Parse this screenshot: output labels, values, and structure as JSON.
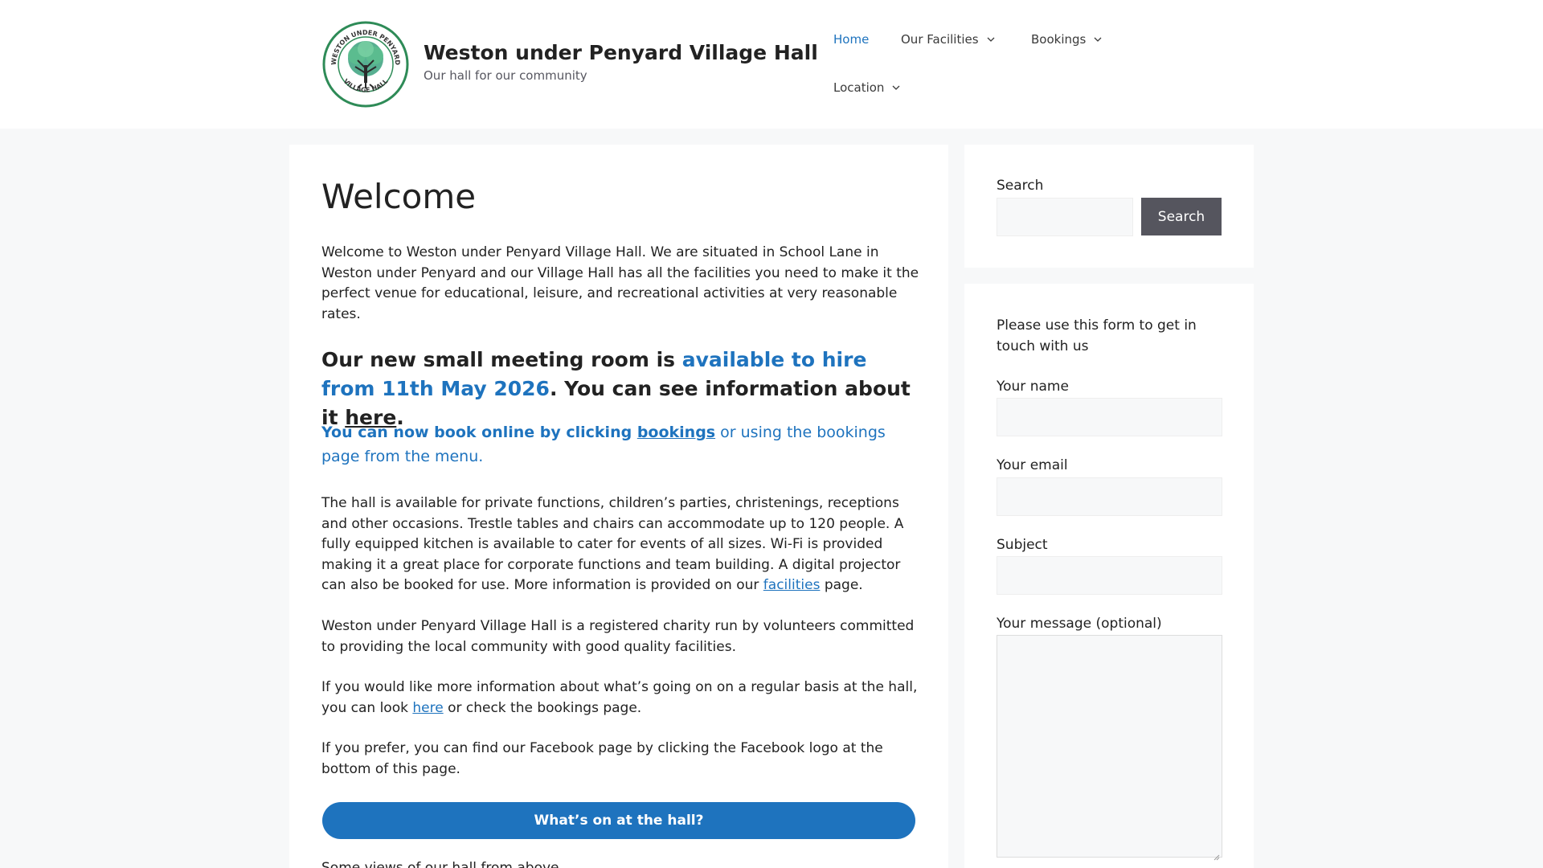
{
  "header": {
    "site_title": "Weston under Penyard Village Hall",
    "tagline": "Our hall for our community",
    "logo_text_top": "WESTON UNDER PENYARD",
    "logo_text_bottom": "VILLAGE HALL",
    "logo_icon": "tree-logo-icon",
    "nav": {
      "home": "Home",
      "facilities": "Our Facilities",
      "bookings": "Bookings",
      "location": "Location"
    }
  },
  "main": {
    "title": "Welcome",
    "intro": "Welcome to Weston under Penyard Village Hall. We are situated in School Lane in Weston under Penyard and our Village Hall has all the facilities you need to make it the perfect venue for educational, leisure, and recreational activities at very reasonable rates.",
    "notice": {
      "prefix": "Our new small meeting room is ",
      "highlight": "available to hire from 11th May 2026",
      "middle": ". You can see information about it ",
      "link": "here",
      "suffix": "."
    },
    "online": {
      "prefix": "You can now book online by clicking ",
      "link": "bookings",
      "suffix": " or using the bookings page from the menu."
    },
    "hall_info": {
      "text": "The hall is available for private functions, children’s parties, christenings, receptions and other occasions. Trestle tables and chairs can accommodate up to 120 people. A fully equipped kitchen is available to cater for events of all sizes. Wi-Fi is provided making it a great place for corporate functions and team building. A digital projector can also be booked for use. More information is provided on our ",
      "link": "facilities",
      "suffix": " page."
    },
    "charity": "Weston under Penyard Village Hall is a registered charity run by volunteers committed to providing the local community with good quality facilities.",
    "more_info": {
      "prefix": "If you would like more information about what’s going on on a regular basis at the hall, you can look ",
      "link": "here",
      "suffix": " or check the bookings page."
    },
    "facebook": "If you prefer, you can find our Facebook page by clicking the Facebook logo at the bottom of this page.",
    "whats_on_button": "What’s on at the hall?",
    "views_caption": "Some views of our hall from above"
  },
  "sidebar": {
    "search": {
      "label": "Search",
      "placeholder": "",
      "button": "Search"
    },
    "contact": {
      "intro": "Please use this form to get in touch with us",
      "name_label": "Your name",
      "email_label": "Your email",
      "subject_label": "Subject",
      "message_label": "Your message (optional)"
    }
  },
  "colors": {
    "accent": "#1e73be",
    "background": "#f7f8f9",
    "search_button": "#55555e",
    "logo_green": "#2e8b57"
  }
}
